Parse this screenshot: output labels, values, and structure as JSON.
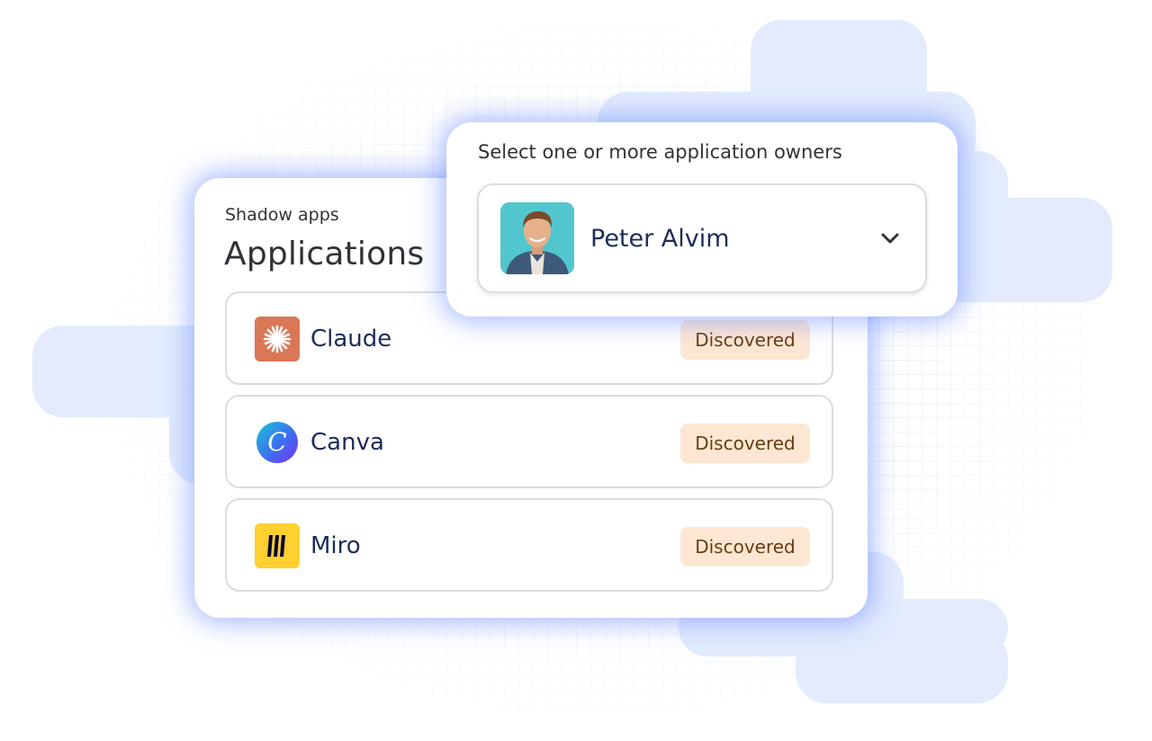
{
  "apps_card": {
    "subtitle": "Shadow apps",
    "title": "Applications",
    "items": [
      {
        "name": "Claude",
        "status": "Discovered",
        "icon": "claude-logo-icon"
      },
      {
        "name": "Canva",
        "status": "Discovered",
        "icon": "canva-logo-icon"
      },
      {
        "name": "Miro",
        "status": "Discovered",
        "icon": "miro-logo-icon"
      }
    ]
  },
  "owners_card": {
    "label": "Select one or more application owners",
    "selected_owner": "Peter Alvim",
    "dropdown_icon": "chevron-down-icon"
  },
  "colors": {
    "accent_glow": "#6686ff",
    "background_blob": "#e3ebfd",
    "badge_bg": "#fde7d3",
    "badge_text": "#6b3a0f",
    "text_primary": "#1e2c5a",
    "claude_brand": "#d97757",
    "miro_brand": "#ffd02f"
  }
}
